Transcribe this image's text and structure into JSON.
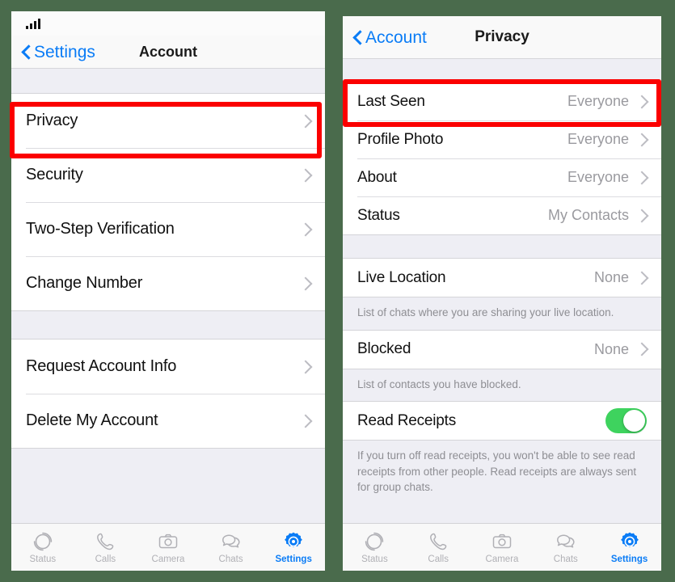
{
  "left_phone": {
    "status_bar": {
      "signal_icon": "signal-bars-icon"
    },
    "navbar": {
      "back_label": "Settings",
      "title": "Account"
    },
    "groups": [
      {
        "rows": [
          {
            "label": "Privacy",
            "value": "",
            "accessory": "chevron-right-icon"
          },
          {
            "label": "Security",
            "value": "",
            "accessory": "chevron-right-icon"
          },
          {
            "label": "Two-Step Verification",
            "value": "",
            "accessory": "chevron-right-icon"
          },
          {
            "label": "Change Number",
            "value": "",
            "accessory": "chevron-right-icon"
          }
        ]
      },
      {
        "rows": [
          {
            "label": "Request Account Info",
            "value": "",
            "accessory": "chevron-right-icon"
          },
          {
            "label": "Delete My Account",
            "value": "",
            "accessory": "chevron-right-icon"
          }
        ]
      }
    ],
    "tabs": [
      {
        "label": "Status",
        "icon": "status-ring-icon",
        "active": false
      },
      {
        "label": "Calls",
        "icon": "phone-handset-icon",
        "active": false
      },
      {
        "label": "Camera",
        "icon": "camera-icon",
        "active": false
      },
      {
        "label": "Chats",
        "icon": "chat-bubbles-icon",
        "active": false
      },
      {
        "label": "Settings",
        "icon": "gear-icon",
        "active": true
      }
    ]
  },
  "right_phone": {
    "navbar": {
      "back_label": "Account",
      "title": "Privacy"
    },
    "groups": [
      {
        "rows": [
          {
            "label": "Last Seen",
            "value": "Everyone",
            "accessory": "chevron-right-icon"
          },
          {
            "label": "Profile Photo",
            "value": "Everyone",
            "accessory": "chevron-right-icon"
          },
          {
            "label": "About",
            "value": "Everyone",
            "accessory": "chevron-right-icon"
          },
          {
            "label": "Status",
            "value": "My Contacts",
            "accessory": "chevron-right-icon"
          }
        ],
        "footnote": ""
      },
      {
        "rows": [
          {
            "label": "Live Location",
            "value": "None",
            "accessory": "chevron-right-icon"
          }
        ],
        "footnote": "List of chats where you are sharing your live location."
      },
      {
        "rows": [
          {
            "label": "Blocked",
            "value": "None",
            "accessory": "chevron-right-icon"
          }
        ],
        "footnote": "List of contacts you have blocked."
      },
      {
        "rows": [
          {
            "label": "Read Receipts",
            "value": "",
            "accessory": "toggle-switch",
            "toggle_on": true
          }
        ],
        "footnote": "If you turn off read receipts, you won't be able to see read receipts from other people. Read receipts are always sent for group chats."
      }
    ],
    "tabs": [
      {
        "label": "Status",
        "icon": "status-ring-icon",
        "active": false
      },
      {
        "label": "Calls",
        "icon": "phone-handset-icon",
        "active": false
      },
      {
        "label": "Camera",
        "icon": "camera-icon",
        "active": false
      },
      {
        "label": "Chats",
        "icon": "chat-bubbles-icon",
        "active": false
      },
      {
        "label": "Settings",
        "icon": "gear-icon",
        "active": true
      }
    ]
  },
  "annotations": {
    "highlight_color": "#fb0000",
    "highlighted_items": [
      "Privacy",
      "Last Seen"
    ]
  },
  "colors": {
    "accent_blue": "#0a7cf6",
    "toggle_green": "#3ed35e",
    "background_green": "#4a6b4c",
    "group_background": "#ffffff",
    "page_background": "#eeeef4",
    "secondary_text": "#8e8e93"
  }
}
